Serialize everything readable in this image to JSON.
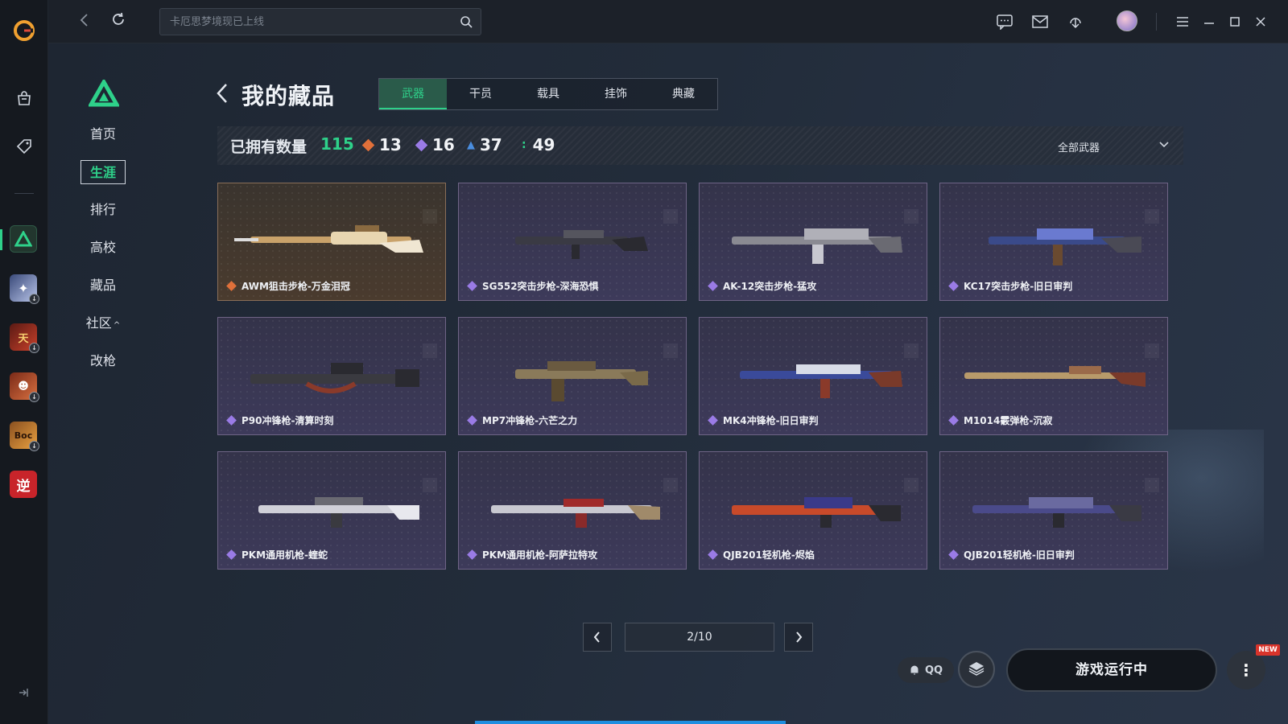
{
  "app": {
    "search_placeholder": "卡厄思梦境现已上线"
  },
  "section_nav": {
    "items": [
      {
        "label": "首页"
      },
      {
        "label": "生涯"
      },
      {
        "label": "排行"
      },
      {
        "label": "高校"
      },
      {
        "label": "藏品"
      },
      {
        "label": "社区"
      },
      {
        "label": "改枪"
      }
    ],
    "active_index": 1
  },
  "page": {
    "title": "我的藏品",
    "tabs": [
      {
        "label": "武器"
      },
      {
        "label": "干员"
      },
      {
        "label": "载具"
      },
      {
        "label": "挂饰"
      },
      {
        "label": "典藏"
      }
    ],
    "active_tab": 0
  },
  "stats": {
    "owned_label": "已拥有数量",
    "owned_total": "115",
    "counts": [
      {
        "value": "13",
        "color": "#e0703a"
      },
      {
        "value": "16",
        "color": "#9a7be6"
      },
      {
        "value": "37",
        "color": "#4a8ee0"
      },
      {
        "value": "49",
        "color": "#2ed18a"
      }
    ],
    "filter_label": "全部武器"
  },
  "items": [
    {
      "name": "AWM狙击步枪-万金泪冠",
      "rarity_color": "#e0703a"
    },
    {
      "name": "SG552突击步枪-深海恐惧",
      "rarity_color": "#9a7be6"
    },
    {
      "name": "AK-12突击步枪-猛攻",
      "rarity_color": "#9a7be6"
    },
    {
      "name": "KC17突击步枪-旧日审判",
      "rarity_color": "#9a7be6"
    },
    {
      "name": "P90冲锋枪-清算时刻",
      "rarity_color": "#9a7be6"
    },
    {
      "name": "MP7冲锋枪-六芒之力",
      "rarity_color": "#9a7be6"
    },
    {
      "name": "MK4冲锋枪-旧日审判",
      "rarity_color": "#9a7be6"
    },
    {
      "name": "M1014霰弹枪-沉寂",
      "rarity_color": "#9a7be6"
    },
    {
      "name": "PKM通用机枪-蝰蛇",
      "rarity_color": "#9a7be6"
    },
    {
      "name": "PKM通用机枪-阿萨拉特攻",
      "rarity_color": "#9a7be6"
    },
    {
      "name": "QJB201轻机枪-烬焰",
      "rarity_color": "#9a7be6"
    },
    {
      "name": "QJB201轻机枪-旧日审判",
      "rarity_color": "#9a7be6"
    }
  ],
  "pagination": {
    "page_display": "2/10"
  },
  "bottom": {
    "qq_label": "QQ",
    "play_status": "游戏运行中",
    "new_badge": "NEW"
  },
  "colors": {
    "accent": "#2ed18a",
    "card_border": "#6f6486",
    "background": "#1e2530"
  },
  "icons": [
    "app-logo-icon",
    "store-bag-icon",
    "tag-icon",
    "delta-force-icon",
    "back-icon",
    "refresh-icon",
    "search-icon",
    "chat-icon",
    "mail-icon",
    "download-icon",
    "menu-icon",
    "minimize-icon",
    "maximize-icon",
    "close-icon",
    "chevron-down-icon",
    "chevron-left-icon",
    "chevron-right-icon",
    "bell-icon",
    "cube-icon",
    "more-vertical-icon",
    "collapse-icon"
  ]
}
